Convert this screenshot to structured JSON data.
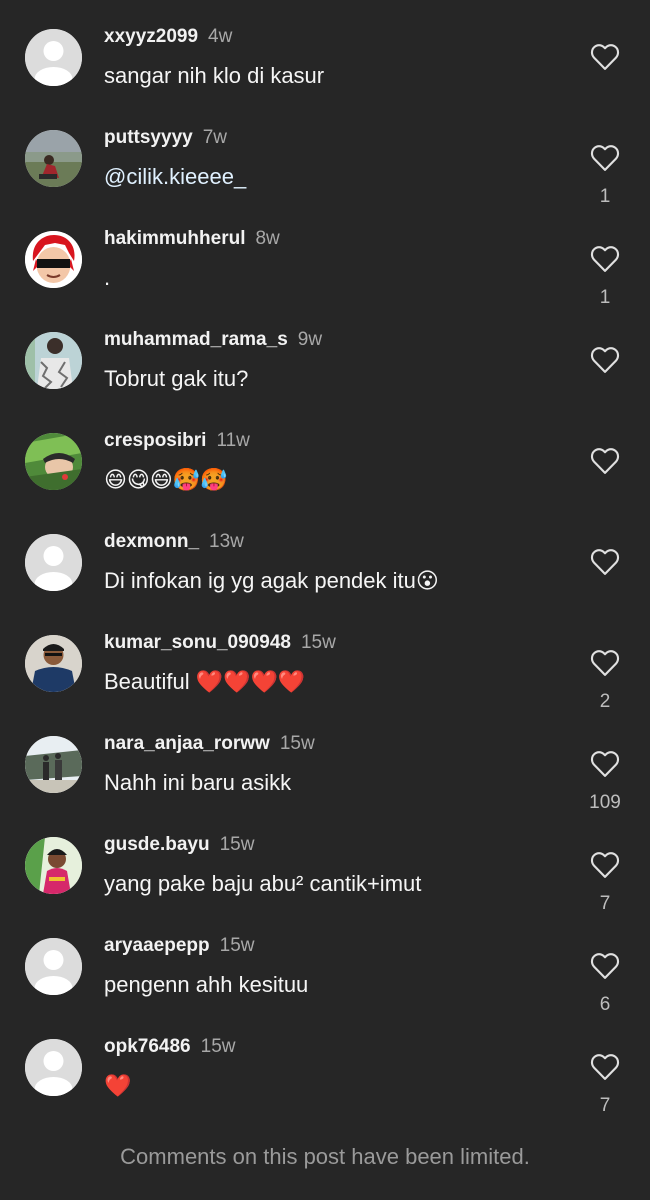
{
  "comments": [
    {
      "username": "xxyyz2099",
      "time": "4w",
      "text": "sangar nih klo di kasur",
      "likes": "",
      "avatar": "default-avatar"
    },
    {
      "username": "puttsyyyy",
      "time": "7w",
      "text": "@cilik.kieeee_",
      "likes": "1",
      "avatar": "photo-avatar"
    },
    {
      "username": "hakimmuhherul",
      "time": "8w",
      "text": ".",
      "likes": "1",
      "avatar": "cartoon-avatar"
    },
    {
      "username": "muhammad_rama_s",
      "time": "9w",
      "text": "Tobrut gak itu?",
      "likes": "",
      "avatar": "photo-avatar"
    },
    {
      "username": "cresposibri",
      "time": "11w",
      "text": "😄😋😄🥵🥵",
      "likes": "",
      "avatar": "photo-avatar"
    },
    {
      "username": "dexmonn_",
      "time": "13w",
      "text": "Di infokan ig yg agak pendek itu😮",
      "likes": "",
      "avatar": "default-avatar"
    },
    {
      "username": "kumar_sonu_090948",
      "time": "15w",
      "text": "Beautiful ❤️❤️❤️❤️",
      "likes": "2",
      "avatar": "photo-avatar"
    },
    {
      "username": "nara_anjaa_rorww",
      "time": "15w",
      "text": "Nahh ini baru asikk",
      "likes": "109",
      "avatar": "photo-avatar"
    },
    {
      "username": "gusde.bayu",
      "time": "15w",
      "text": "yang pake baju abu² cantik+imut",
      "likes": "7",
      "avatar": "photo-avatar"
    },
    {
      "username": "aryaaepepp",
      "time": "15w",
      "text": "pengenn ahh kesituu",
      "likes": "6",
      "avatar": "default-avatar"
    },
    {
      "username": "opk76486",
      "time": "15w",
      "text": "❤️",
      "likes": "7",
      "avatar": "default-avatar"
    }
  ],
  "footer": "Comments on this post have been limited.",
  "colors": {
    "background": "#262626",
    "username": "#f2f2f2",
    "timestamp": "#a8a8a8",
    "comment_text": "#f5f5f5",
    "like_count": "#bdbdbd",
    "footer_text": "#9a9a9a",
    "heart_emoji": "#e0202b"
  },
  "icons": {
    "like": "heart-outline-icon",
    "avatar_default": "person-silhouette-icon"
  }
}
